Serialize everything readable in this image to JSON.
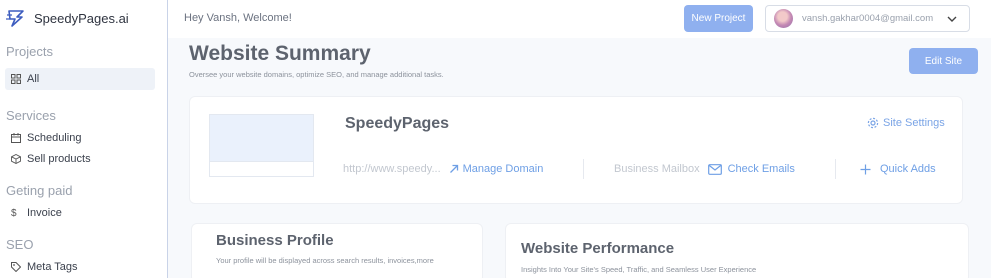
{
  "brand": {
    "name": "SpeedyPages.ai"
  },
  "sidebar": {
    "sections": [
      {
        "title": "Projects",
        "items": [
          {
            "label": "All",
            "icon": "grid-icon"
          }
        ]
      },
      {
        "title": "Services",
        "items": [
          {
            "label": "Scheduling",
            "icon": "calendar-icon"
          },
          {
            "label": "Sell products",
            "icon": "box-icon"
          }
        ]
      },
      {
        "title": "Geting paid",
        "items": [
          {
            "label": "Invoice",
            "icon": "dollar-icon"
          }
        ]
      },
      {
        "title": "SEO",
        "items": [
          {
            "label": "Meta Tags",
            "icon": "tag-icon"
          }
        ]
      }
    ]
  },
  "header": {
    "greeting": "Hey Vansh, Welcome!",
    "new_project_label": "New Project",
    "account_email": "vansh.gakhar0004@gmail.com"
  },
  "main": {
    "title": "Website Summary",
    "subtitle": "Oversee your website domains, optimize SEO, and manage additional tasks.",
    "edit_site_label": "Edit Site",
    "site": {
      "name": "SpeedyPages",
      "settings_label": "Site Settings",
      "url": "http://www.speedy...",
      "manage_domain_label": "Manage Domain",
      "mailbox_label": "Business Mailbox",
      "check_emails_label": "Check Emails",
      "quick_adds_label": "Quick Adds"
    },
    "profile_card": {
      "title": "Business Profile",
      "subtitle": "Your profile will be displayed across search results, invoices,more"
    },
    "performance_card": {
      "title": "Website Performance",
      "subtitle": "Insights Into Your Site's Speed, Traffic, and Seamless User Experience"
    }
  },
  "colors": {
    "accent": "#8fb0ef",
    "link": "#6e9fe5",
    "sidebar_border": "#c9d3e8"
  }
}
